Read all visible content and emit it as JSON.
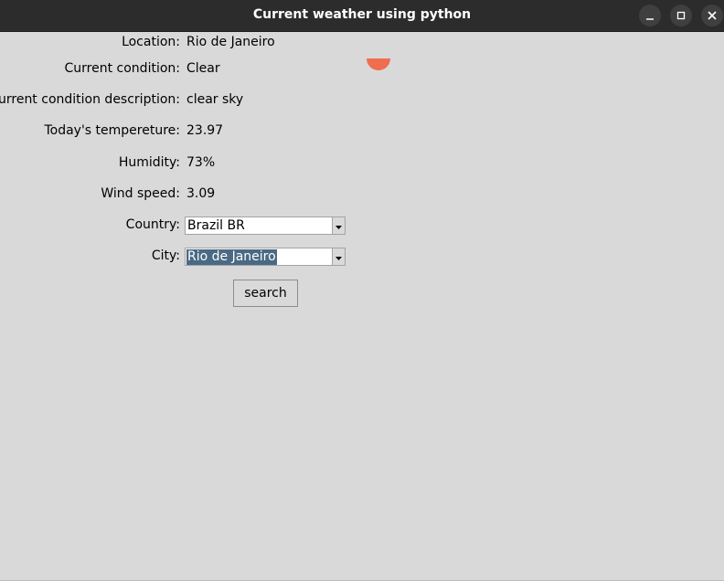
{
  "window": {
    "title": "Current weather using python"
  },
  "fields": [
    {
      "label": "Location:",
      "value": "Rio de Janeiro"
    },
    {
      "label": "Current condition:",
      "value": "Clear"
    },
    {
      "label": "Current condition description:",
      "value": "clear sky"
    },
    {
      "label": "Today's tempereture:",
      "value": "23.97"
    },
    {
      "label": "Humidity:",
      "value": "73%"
    },
    {
      "label": "Wind speed:",
      "value": "3.09"
    }
  ],
  "country": {
    "label": "Country:",
    "selected": "Brazil BR"
  },
  "city": {
    "label": "City:",
    "selected": "Rio de Janeiro"
  },
  "search": {
    "label": "search"
  },
  "weather_icon": {
    "name": "sun-icon",
    "color": "#ee6e4f"
  }
}
